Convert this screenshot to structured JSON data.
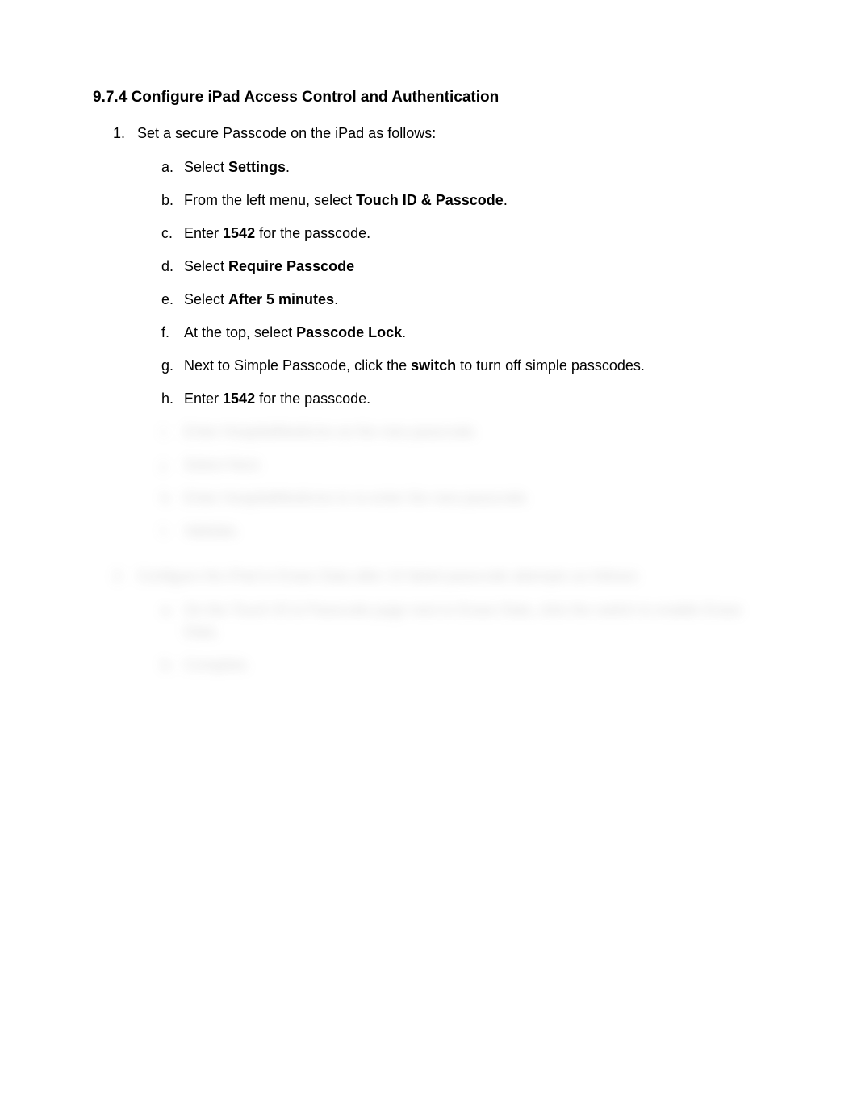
{
  "heading": "9.7.4 Configure iPad Access Control and Authentication",
  "step1": {
    "num": "1.",
    "intro": "Set a secure Passcode on the iPad as follows:",
    "items": {
      "a": {
        "letter": "a.",
        "pre": "Select ",
        "bold": "Settings",
        "post": "."
      },
      "b": {
        "letter": "b.",
        "pre": "From the left menu, select ",
        "bold": "Touch ID & Passcode",
        "post": "."
      },
      "c": {
        "letter": "c.",
        "pre": "Enter ",
        "bold": "1542",
        "post": " for the passcode."
      },
      "d": {
        "letter": "d.",
        "pre": "Select ",
        "bold": "Require Passcode",
        "post": ""
      },
      "e": {
        "letter": "e.",
        "pre": "Select ",
        "bold": "After 5 minutes",
        "post": "."
      },
      "f": {
        "letter": "f.",
        "pre": "At the top, select ",
        "bold": "Passcode Lock",
        "post": "."
      },
      "g": {
        "letter": "g.",
        "pre": "Next to Simple Passcode, click the ",
        "bold": "switch",
        "post": " to turn off simple passcodes."
      },
      "h": {
        "letter": "h.",
        "pre": "Enter ",
        "bold": "1542",
        "post": " for the passcode."
      }
    }
  },
  "blurred": {
    "step1_cont": {
      "i": {
        "letter": "i.",
        "text": "Enter HospitalMedicine as the new passcode."
      },
      "j": {
        "letter": "j.",
        "text": "Select Next."
      },
      "k": {
        "letter": "k.",
        "text": "Enter HospitalMedicine to re-enter the new passcode."
      },
      "l": {
        "letter": "l.",
        "text": "Validate."
      }
    },
    "step2": {
      "num": "2.",
      "intro": "Configure the iPad to Erase Data after 10 failed passcode attempts as follows:",
      "a": {
        "letter": "a.",
        "text": "On the Touch ID & Passcode page next to Erase Data, click the switch to enable Erase Data."
      },
      "b": {
        "letter": "b.",
        "text": "Complete."
      }
    }
  }
}
